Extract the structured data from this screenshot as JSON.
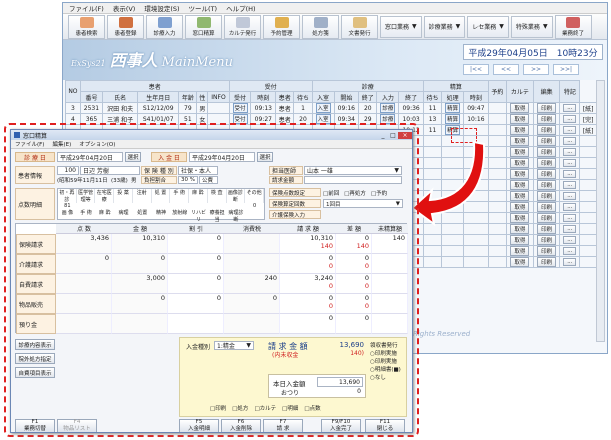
{
  "main": {
    "menu": [
      "ファイル(F)",
      "表示(V)",
      "環境設定(S)",
      "ツール(T)",
      "ヘルプ(H)"
    ],
    "toolbar": [
      "患者検索",
      "患者登録",
      "診療入力",
      "窓口精算",
      "カルテ発行",
      "予約管理",
      "処方箋"
    ],
    "toolbar2": [
      "文書発行",
      "窓口業務",
      "診療業務",
      "レセ業務",
      "特殊業務",
      "業務終了"
    ],
    "brand_pre": "ExSys21",
    "brand_name": "西事人",
    "brand_post": "MainMenu",
    "date": "平成29年04月05日　10時23分",
    "nav": [
      "|<<",
      "<<",
      ">>",
      ">>|"
    ],
    "group_headers": {
      "patient": "患者",
      "reception": "受付",
      "exam": "診療",
      "account": "精算",
      "remark": "特記"
    },
    "columns": [
      "NO",
      "番号",
      "氏名",
      "生年月日",
      "年齢",
      "性",
      "INFO",
      "受付",
      "時刻",
      "患者",
      "待ち",
      "入室",
      "開始",
      "終了",
      "入力",
      "終了",
      "待ち",
      "処理",
      "時刻",
      "予約",
      "カルテ",
      "編集"
    ],
    "rows": [
      {
        "no": "3",
        "num": "2531",
        "name": "沢田 和夫",
        "birth": "S12/12/09",
        "age": "79",
        "sex": "男",
        "rec": "受付",
        "rtime": "09:13",
        "pt": "患者",
        "wait": "1",
        "room": "入室",
        "start": "09:16",
        "end": "20",
        "input": "診療",
        "fin": "09:36",
        "w2": "11",
        "proc": "精算",
        "ptime": "09:47",
        "res": "",
        "karte": "取得",
        "edit": "印刷",
        "btn": "...",
        "rem": "[紙]"
      },
      {
        "no": "4",
        "num": "365",
        "name": "三浦 和子",
        "birth": "S41/01/07",
        "age": "51",
        "sex": "女",
        "rec": "受付",
        "rtime": "09:27",
        "pt": "患者",
        "wait": "20",
        "room": "入室",
        "start": "09:34",
        "end": "29",
        "input": "診療",
        "fin": "10:03",
        "w2": "13",
        "proc": "精算",
        "ptime": "10:16",
        "res": "",
        "karte": "取得",
        "edit": "印刷",
        "btn": "...",
        "rem": "[完]"
      },
      {
        "no": "",
        "num": "",
        "name": "",
        "birth": "",
        "age": "",
        "sex": "",
        "rec": "",
        "rtime": "",
        "pt": "",
        "wait": "",
        "room": "",
        "start": "",
        "end": "",
        "input": "",
        "fin": "10:12",
        "w2": "11",
        "proc": "精算",
        "ptime": "",
        "res": "",
        "karte": "取得",
        "edit": "印刷",
        "btn": "...",
        "rem": "[紙]"
      }
    ],
    "extra_rows": 12,
    "footer_text": "Rights Reserved"
  },
  "sub": {
    "title": "窓口精算",
    "menu": [
      "ファイル(F)",
      "編集(E)",
      "オプション(O)"
    ],
    "exam_day_label": "診 療 日",
    "exam_day": "平成29年04月20日",
    "btn_select": "選択",
    "receipt_day_label": "入 金 日",
    "receipt_day": "平成29年04月20日",
    "btn_select2": "選択",
    "patient_label": "患者情報",
    "patient_id": "100",
    "patient_name": "日辺 芳樹",
    "insurance_label": "保 険 種 別",
    "insurance": "社保・本人",
    "birth": "(昭和59年11月11日",
    "age": "(33歳)",
    "sex": "男",
    "burden_label": "負担割合",
    "burden": "30 %",
    "public": "公費",
    "doctor_label": "担当医師",
    "doctor": "山本 一雄",
    "payer_label": "請求金額",
    "detail_label": "点数明細",
    "pts_head": [
      "初・再診",
      "医学管理等",
      "在宅医療",
      "投 薬",
      "注射",
      "処 置",
      "手 術",
      "麻 酔",
      "検 査",
      "画像診断",
      "その他"
    ],
    "pts_val": [
      "81",
      "",
      "",
      "",
      "",
      "",
      "",
      "",
      "",
      "",
      "0"
    ],
    "pts_head2": [
      "画 像",
      "手 術",
      "麻 酔",
      "病理",
      "処置",
      "精神",
      "放射線",
      "リハビリ",
      "療養担当",
      "病理診断"
    ],
    "pts_val2": [
      "0",
      "",
      "",
      "",
      "",
      "",
      "3,385",
      "",
      "",
      "0"
    ],
    "rows_right": [
      "保険点数設定",
      "保険算定回数",
      "介護保険入力"
    ],
    "checks": [
      "前回",
      "再処方",
      "予約"
    ],
    "cols": [
      "点 数",
      "金 額",
      "割 引",
      "消費税",
      "請 求 額",
      "差 額",
      "未精算額"
    ],
    "lines": [
      {
        "label": "保険請求",
        "pts": "3,436",
        "amt": "10,310",
        "disc": "0",
        "tax": "",
        "req": "10,310",
        "req2": "140",
        "diff": "0",
        "diff2": "140",
        "unpaid": "140"
      },
      {
        "label": "介護請求",
        "pts": "0",
        "amt": "0",
        "disc": "0",
        "tax": "",
        "req": "0",
        "req2": "0",
        "diff": "0",
        "diff2": "0",
        "unpaid": ""
      },
      {
        "label": "自費請求",
        "pts": "",
        "amt": "3,000",
        "disc": "0",
        "tax": "240",
        "req": "3,240",
        "req2": "0",
        "diff": "0",
        "diff2": "0",
        "unpaid": ""
      },
      {
        "label": "物品販売",
        "pts": "",
        "amt": "0",
        "disc": "0",
        "tax": "0",
        "req": "0",
        "req2": "0",
        "diff": "0",
        "diff2": "0",
        "unpaid": ""
      },
      {
        "label": "預り金",
        "pts": "",
        "amt": "",
        "disc": "",
        "tax": "",
        "req": "0",
        "req2": "",
        "diff": "0",
        "diff2": "",
        "unpaid": ""
      }
    ],
    "side": [
      "診療内容表示",
      "院外処方指定",
      "自費項目表示"
    ],
    "pay_type_label": "入金種別",
    "pay_type": "1:精金",
    "total_label": "請 求 金 額",
    "total": "13,690",
    "uncol_label": "(内未収金",
    "uncol": "140)",
    "today_label": "本日入金額",
    "today": "13,690",
    "change_label": "おつり",
    "change": "0",
    "print_label": "領収書発行",
    "radio": [
      "印刷実施",
      "印刷実施",
      "明細書(■)",
      "なし"
    ],
    "chk_bottom": [
      "印刷",
      "処方",
      "カルテ",
      "明細",
      "点数"
    ],
    "fkeys": [
      {
        "k": "F1",
        "t": "業務切替"
      },
      {
        "k": "F4",
        "t": "物品リスト"
      },
      {
        "k": "F5",
        "t": "入金明細"
      },
      {
        "k": "F6",
        "t": "入金削除"
      },
      {
        "k": "F7",
        "t": "請 求"
      },
      {
        "k": "F9/F10",
        "t": "入金完了"
      },
      {
        "k": "F11",
        "t": "閉じる"
      }
    ]
  },
  "colors": {
    "accent_red": "#e01010",
    "dash": "#e02020",
    "brand_bg": "#b4cbe3"
  }
}
